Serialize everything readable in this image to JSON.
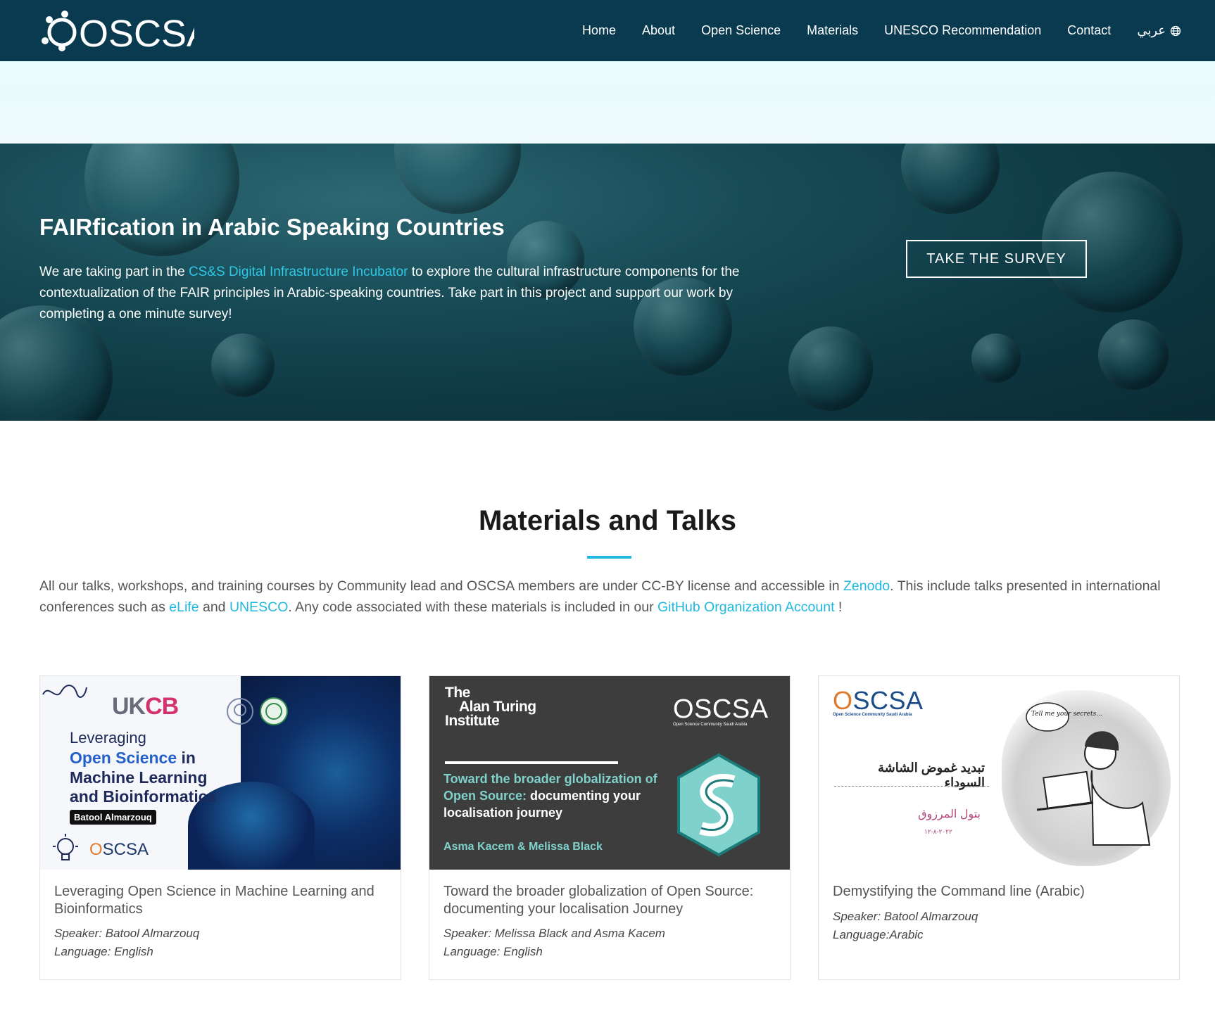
{
  "nav": {
    "logo_text": "OSCSA",
    "items": [
      "Home",
      "About",
      "Open Science",
      "Materials",
      "UNESCO Recommendation",
      "Contact"
    ],
    "lang_label": "عربي",
    "icons": {
      "language": "globe-icon"
    }
  },
  "hero": {
    "title": "FAIRfication in Arabic Speaking Countries",
    "text_before": "We are taking part in the ",
    "link_text": "CS&S Digital Infrastructure Incubator",
    "text_after": " to explore the cultural infrastructure components for the contextualization of the FAIR principles in Arabic-speaking countries. Take part in this project and support our work by completing a one minute survey!",
    "button_label": "TAKE THE SURVEY"
  },
  "materials": {
    "title": "Materials and Talks",
    "text": {
      "p1": "All our talks, workshops, and training courses by Community lead and OSCSA members are under CC-BY license and accessible in ",
      "zenodo": "Zenodo",
      "p2": ". This include talks presented in international conferences such as ",
      "elife": "eLife",
      "p3": " and ",
      "unesco": "UNESCO",
      "p4": ". Any code associated with these materials is included in our ",
      "github": "GitHub Organization Account",
      "p5": " !"
    }
  },
  "cards": [
    {
      "title": "Leveraging Open Science in Machine Learning and Bioinformatics",
      "speaker": "Speaker: Batool Almarzouq",
      "language": "Language: English",
      "image": {
        "conference": "UK",
        "conference_accent": "CB",
        "line1": "Leveraging",
        "line2_accent": "Open Science",
        "line2_rest": " in",
        "line3": "Machine Learning",
        "line4": "and Bioinformatics",
        "tag": "Batool Almarzouq",
        "logo_o": "O",
        "logo_rest": "SCSA"
      }
    },
    {
      "title": "Toward the broader globalization of Open Source: documenting your localisation Journey",
      "speaker": "Speaker: Melissa Black and Asma Kacem",
      "language": "Language: English",
      "image": {
        "institute_line1": "The",
        "institute_line2": "Alan Turing",
        "institute_line3": "Institute",
        "logo": "OSCSA",
        "logo_sub": "Open Science Community Saudi Arabia",
        "talk_teal": "Toward the broader globalization of Open Source:",
        "talk_white": " documenting your localisation journey",
        "authors": "Asma Kacem & Melissa Black",
        "badge": "The Turing Way"
      }
    },
    {
      "title": "Demystifying the Command line (Arabic)",
      "speaker": "Speaker: Batool Almarzouq",
      "language": "Language:Arabic",
      "image": {
        "logo_o": "O",
        "logo_rest": "SCSA",
        "logo_sub": "Open Science Community Saudi Arabia",
        "ar_title": "تبديد غموض الشاشة السوداء",
        "ar_name": "بتول المرزوق",
        "ar_date": "٢٠٢٢-٨-١٢",
        "bubble": "Tell me your secrets..."
      }
    }
  ],
  "colors": {
    "nav_bg": "#0a3a4f",
    "accent": "#1fb9e0",
    "hero_link": "#2fc8e5"
  }
}
